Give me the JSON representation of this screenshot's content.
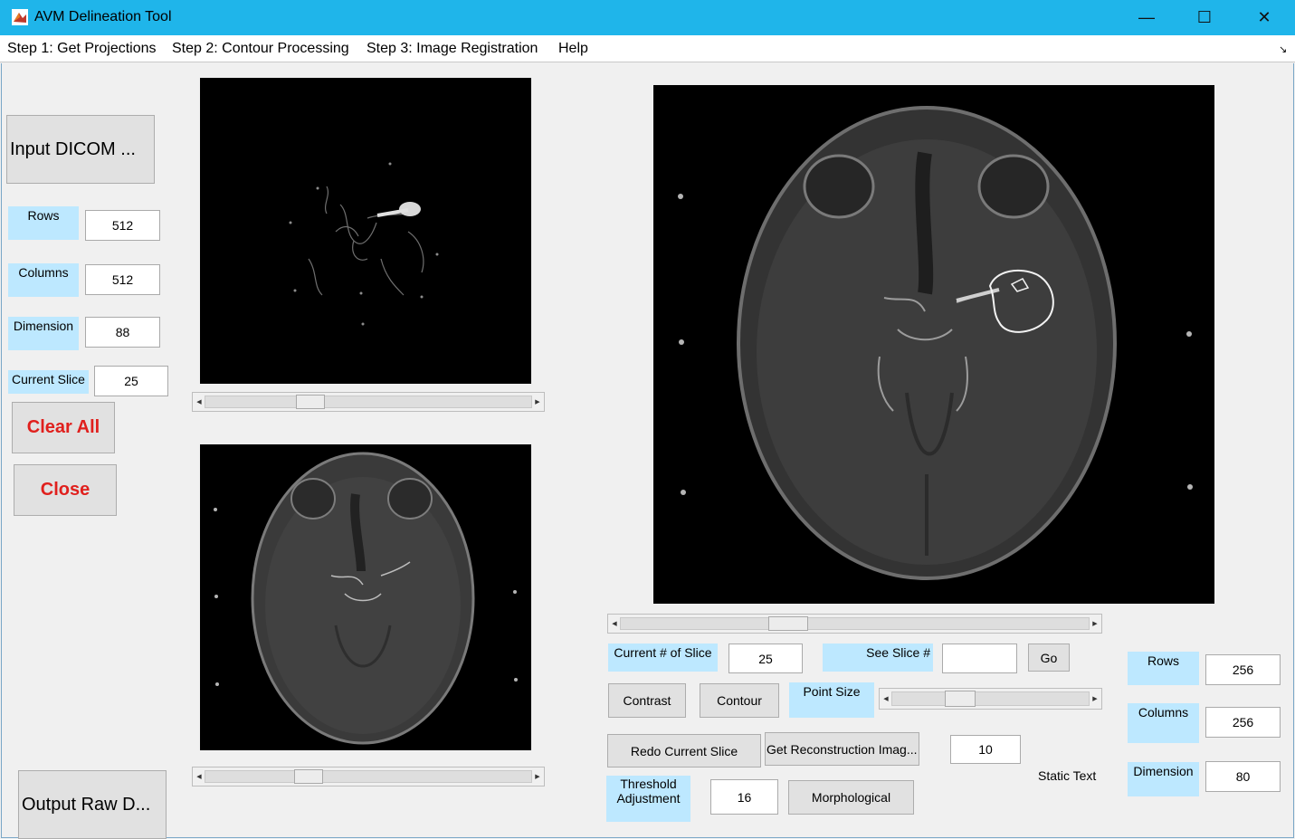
{
  "window": {
    "title": "AVM Delineation Tool",
    "minimize_glyph": "—",
    "maximize_glyph": "☐",
    "close_glyph": "✕",
    "accent_color": "#1fb5ea"
  },
  "menu": {
    "items": [
      "Step 1: Get Projections",
      "Step 2: Contour Processing",
      "Step 3: Image Registration",
      "Help"
    ],
    "toggle_glyph": "↘"
  },
  "left_panel": {
    "input_dicom": "Input DICOM ...",
    "rows_label": "Rows",
    "rows_value": "512",
    "columns_label": "Columns",
    "columns_value": "512",
    "dimension_label": "Dimension",
    "dimension_value": "88",
    "current_slice_label": "Current Slice",
    "current_slice_value": "25",
    "clear_all": "Clear All",
    "close": "Close",
    "output_raw": "Output Raw D..."
  },
  "images": {
    "top_left": "mip-projection",
    "bottom_left": "axial-slice",
    "right": "contoured-slice"
  },
  "right_panel": {
    "current_slice_label": "Current # of Slice",
    "current_slice_value": "25",
    "see_slice_label": "See Slice #",
    "see_slice_value": "",
    "go": "Go",
    "contrast": "Contrast",
    "contour": "Contour",
    "point_size_label": "Point Size",
    "redo_current_slice": "Redo Current Slice",
    "get_reconstruction": "Get Reconstruction Imag...",
    "reconstruction_value": "10",
    "threshold_label_line1": "Threshold",
    "threshold_label_line2": "Adjustment",
    "threshold_value": "16",
    "morphological": "Morphological",
    "static_text": "Static Text",
    "rows_label": "Rows",
    "rows_value": "256",
    "columns_label": "Columns",
    "columns_value": "256",
    "dimension_label": "Dimension",
    "dimension_value": "80"
  },
  "arrows": {
    "left": "◀",
    "right": "▶"
  }
}
